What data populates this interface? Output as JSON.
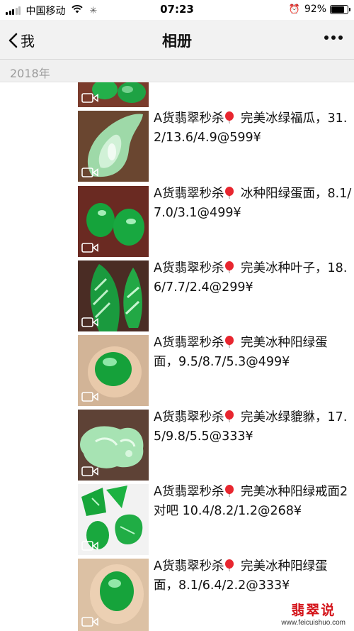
{
  "status": {
    "carrier": "中国移动",
    "time": "07:23",
    "battery": "92%",
    "battery_level": 0.92
  },
  "nav": {
    "back_label": "我",
    "title": "相册"
  },
  "year": "2018年",
  "items": [
    {
      "caption": ""
    },
    {
      "caption_pre": "A货翡翠秒杀",
      "caption_post": " 完美冰绿福瓜，31.2/13.6/4.9@599¥"
    },
    {
      "caption_pre": "A货翡翠秒杀",
      "caption_post": " 冰种阳绿蛋面，8.1/7.0/3.1@499¥"
    },
    {
      "caption_pre": "A货翡翠秒杀",
      "caption_post": " 完美冰种叶子，18.6/7.7/2.4@299¥"
    },
    {
      "caption_pre": "A货翡翠秒杀",
      "caption_post": " 完美冰种阳绿蛋面，9.5/8.7/5.3@499¥"
    },
    {
      "caption_pre": "A货翡翠秒杀",
      "caption_post": " 完美冰绿貔貅，17.5/9.8/5.5@333¥"
    },
    {
      "caption_pre": "A货翡翠秒杀",
      "caption_post": " 完美冰种阳绿戒面2对吧 10.4/8.2/1.2@268¥"
    },
    {
      "caption_pre": "A货翡翠秒杀",
      "caption_post": " 完美冰种阳绿蛋面，8.1/6.4/2.2@333¥"
    }
  ],
  "watermark": {
    "brand": "翡翠说",
    "url": "www.feicuishuo.com"
  },
  "icons": [
    "signal-icon",
    "wifi-icon",
    "loading-icon",
    "alarm-icon",
    "battery-icon",
    "back-chevron-icon",
    "more-icon",
    "video-icon",
    "balloon-icon"
  ],
  "colors": {
    "jade": "#1fa83c",
    "balloon": "#e8262f",
    "watermark": "#d4141a"
  }
}
